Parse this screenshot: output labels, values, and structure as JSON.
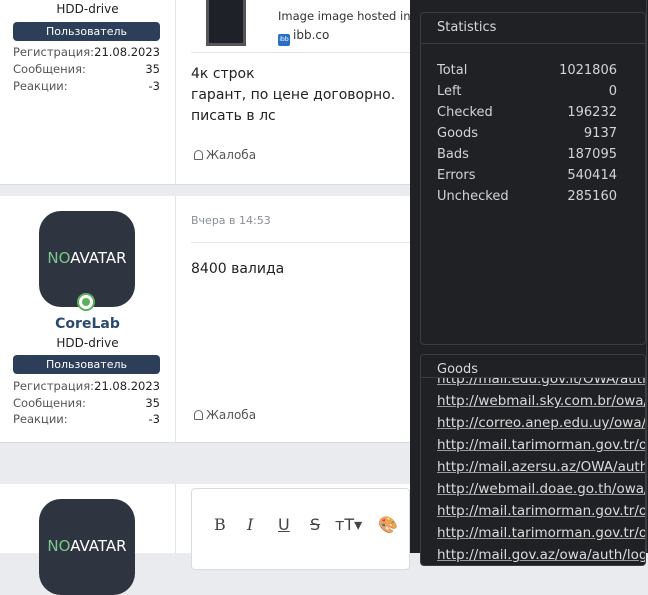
{
  "posts": [
    {
      "user_title": "HDD-drive",
      "badge": "Пользователь",
      "stats": [
        {
          "label": "Регистрация:",
          "value": "21.08.2023"
        },
        {
          "label": "Сообщения:",
          "value": "35"
        },
        {
          "label": "Реакции:",
          "value": "-3"
        }
      ],
      "image_caption": "Image image hosted in Ir",
      "image_host": "ibb.co",
      "message_lines": [
        "4к строк",
        "гарант, по цене договорно.",
        "писать в лс"
      ],
      "report": "Жалоба"
    },
    {
      "avatar_text_no": "NO",
      "avatar_text_rest": "AVATAR",
      "username": "CoreLab",
      "user_title": "HDD-drive",
      "badge": "Пользователь",
      "stats": [
        {
          "label": "Регистрация:",
          "value": "21.08.2023"
        },
        {
          "label": "Сообщения:",
          "value": "35"
        },
        {
          "label": "Реакции:",
          "value": "-3"
        }
      ],
      "time": "Вчера в 14:53",
      "message_lines": [
        "8400 валида"
      ],
      "report": "Жалоба"
    },
    {
      "avatar_text_no": "NO",
      "avatar_text_rest": "AVATAR"
    }
  ],
  "editor": {
    "toolbar": [
      "B",
      "I",
      "U",
      "S",
      "тT▾",
      "🎨"
    ]
  },
  "statistics": {
    "title": "Statistics",
    "rows": [
      {
        "label": "Total",
        "value": "1021806"
      },
      {
        "label": "Left",
        "value": "0"
      },
      {
        "label": "Checked",
        "value": "196232"
      },
      {
        "label": "Goods",
        "value": "9137"
      },
      {
        "label": "Bads",
        "value": "187095"
      },
      {
        "label": "Errors",
        "value": "540414"
      },
      {
        "label": "Unchecked",
        "value": "285160"
      }
    ]
  },
  "goods": {
    "title": "Goods",
    "urls": [
      "http://mail.edu.gov.lt/OWA/auth/lo",
      "http://webmail.sky.com.br/owa/au",
      "http://correo.anep.edu.uy/owa/aut",
      "http://mail.tarimorman.gov.tr/owa",
      "http://mail.azersu.az/OWA/auth/lo",
      "http://webmail.doae.go.th/owa/au",
      "http://mail.tarimorman.gov.tr/owa",
      "http://mail.tarimorman.gov.tr/owa",
      "http://mail.gov.az/owa/auth/logon"
    ]
  }
}
